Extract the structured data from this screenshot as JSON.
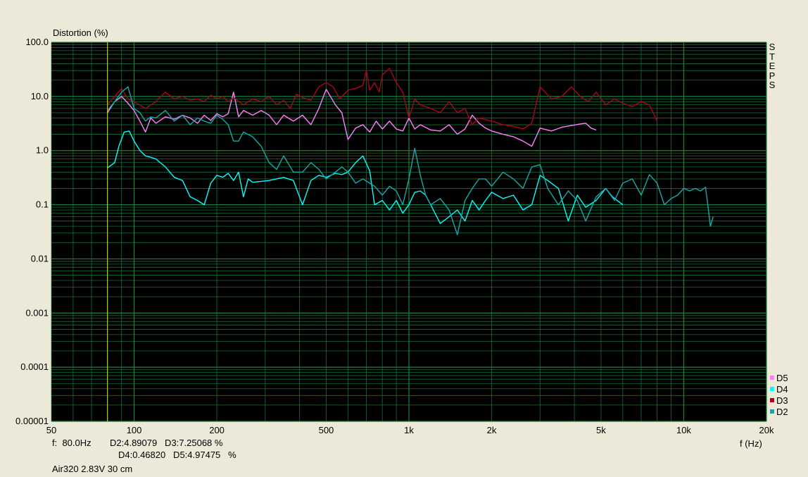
{
  "chart_data": {
    "type": "line",
    "title": "",
    "ylabel": "Distortion (%)",
    "xlabel": "f (Hz)",
    "xscale": "log",
    "yscale": "log",
    "xlim": [
      50,
      20000
    ],
    "ylim": [
      1e-05,
      100
    ],
    "grid": true,
    "background": "#000000",
    "grid_color": "#1f7f3c",
    "x_ticks": [
      "50",
      "100",
      "200",
      "500",
      "1k",
      "2k",
      "5k",
      "10k",
      "20k"
    ],
    "x_tick_values": [
      50,
      100,
      200,
      500,
      1000,
      2000,
      5000,
      10000,
      20000
    ],
    "y_ticks": [
      "100.0",
      "10.0",
      "1.0",
      "0.1",
      "0.01",
      "0.001",
      "0.0001",
      "0.00001"
    ],
    "y_tick_values": [
      100,
      10,
      1,
      0.1,
      0.01,
      0.001,
      0.0001,
      1e-05
    ],
    "cursor_hz": 80,
    "cursor_color": "#e6e600",
    "side_label": "STEPS",
    "legend_position": "bottom-right",
    "series": [
      {
        "name": "D5",
        "color": "#ff80ff",
        "points": [
          [
            80,
            5
          ],
          [
            85,
            8
          ],
          [
            90,
            10
          ],
          [
            95,
            7.5
          ],
          [
            100,
            5.5
          ],
          [
            105,
            3.5
          ],
          [
            110,
            2.2
          ],
          [
            115,
            4
          ],
          [
            120,
            3.2
          ],
          [
            130,
            4.2
          ],
          [
            140,
            3.8
          ],
          [
            150,
            4.5
          ],
          [
            160,
            4
          ],
          [
            170,
            3.2
          ],
          [
            180,
            4.5
          ],
          [
            190,
            3.6
          ],
          [
            200,
            4.8
          ],
          [
            210,
            4.2
          ],
          [
            220,
            4.8
          ],
          [
            230,
            12
          ],
          [
            240,
            4.2
          ],
          [
            250,
            5.5
          ],
          [
            270,
            4.5
          ],
          [
            290,
            5.5
          ],
          [
            310,
            4.5
          ],
          [
            330,
            3
          ],
          [
            350,
            4.5
          ],
          [
            380,
            3.5
          ],
          [
            410,
            4.5
          ],
          [
            440,
            3
          ],
          [
            470,
            6
          ],
          [
            500,
            13.5
          ],
          [
            540,
            7
          ],
          [
            570,
            5
          ],
          [
            600,
            1.6
          ],
          [
            640,
            2.6
          ],
          [
            680,
            3
          ],
          [
            720,
            2.2
          ],
          [
            760,
            3.5
          ],
          [
            800,
            2.5
          ],
          [
            850,
            3.5
          ],
          [
            900,
            2.5
          ],
          [
            950,
            2.3
          ],
          [
            1000,
            4
          ],
          [
            1050,
            2.5
          ],
          [
            1100,
            3
          ],
          [
            1200,
            2.4
          ],
          [
            1300,
            2.3
          ],
          [
            1400,
            3
          ],
          [
            1500,
            2
          ],
          [
            1600,
            2.5
          ],
          [
            1700,
            4.5
          ],
          [
            1800,
            3.2
          ],
          [
            1900,
            2.6
          ],
          [
            2000,
            2.3
          ],
          [
            2200,
            2
          ],
          [
            2400,
            1.8
          ],
          [
            2600,
            1.5
          ],
          [
            2800,
            1.2
          ],
          [
            3000,
            2.6
          ],
          [
            3300,
            2.3
          ],
          [
            3600,
            2.7
          ],
          [
            3900,
            2.9
          ],
          [
            4200,
            3.1
          ],
          [
            4400,
            3.2
          ],
          [
            4600,
            2.6
          ],
          [
            4800,
            2.4
          ]
        ]
      },
      {
        "name": "D4",
        "color": "#00ffff",
        "points": [
          [
            80,
            0.48
          ],
          [
            85,
            0.6
          ],
          [
            88,
            1.2
          ],
          [
            92,
            2.2
          ],
          [
            96,
            2.3
          ],
          [
            100,
            1.5
          ],
          [
            105,
            1
          ],
          [
            110,
            0.8
          ],
          [
            115,
            0.75
          ],
          [
            120,
            0.7
          ],
          [
            130,
            0.5
          ],
          [
            140,
            0.32
          ],
          [
            150,
            0.28
          ],
          [
            160,
            0.14
          ],
          [
            170,
            0.12
          ],
          [
            180,
            0.1
          ],
          [
            190,
            0.25
          ],
          [
            200,
            0.35
          ],
          [
            210,
            0.32
          ],
          [
            220,
            0.38
          ],
          [
            230,
            0.28
          ],
          [
            240,
            0.4
          ],
          [
            250,
            0.14
          ],
          [
            260,
            0.3
          ],
          [
            270,
            0.26
          ],
          [
            290,
            0.27
          ],
          [
            310,
            0.28
          ],
          [
            330,
            0.3
          ],
          [
            350,
            0.32
          ],
          [
            380,
            0.28
          ],
          [
            410,
            0.1
          ],
          [
            440,
            0.28
          ],
          [
            470,
            0.35
          ],
          [
            500,
            0.32
          ],
          [
            540,
            0.38
          ],
          [
            570,
            0.36
          ],
          [
            600,
            0.4
          ],
          [
            640,
            0.6
          ],
          [
            680,
            0.8
          ],
          [
            720,
            0.42
          ],
          [
            750,
            0.1
          ],
          [
            800,
            0.12
          ],
          [
            850,
            0.08
          ],
          [
            900,
            0.12
          ],
          [
            950,
            0.07
          ],
          [
            1000,
            0.1
          ],
          [
            1050,
            0.17
          ],
          [
            1100,
            0.18
          ],
          [
            1150,
            0.15
          ],
          [
            1200,
            0.1
          ],
          [
            1300,
            0.045
          ],
          [
            1400,
            0.06
          ],
          [
            1500,
            0.08
          ],
          [
            1600,
            0.05
          ],
          [
            1700,
            0.12
          ],
          [
            1800,
            0.08
          ],
          [
            1900,
            0.12
          ],
          [
            2000,
            0.17
          ],
          [
            2200,
            0.13
          ],
          [
            2400,
            0.15
          ],
          [
            2600,
            0.08
          ],
          [
            2800,
            0.1
          ],
          [
            3000,
            0.35
          ],
          [
            3200,
            0.28
          ],
          [
            3500,
            0.2
          ],
          [
            3800,
            0.05
          ],
          [
            4100,
            0.15
          ],
          [
            4400,
            0.09
          ],
          [
            4800,
            0.12
          ],
          [
            5200,
            0.2
          ],
          [
            5500,
            0.14
          ],
          [
            6000,
            0.1
          ]
        ]
      },
      {
        "name": "D3",
        "color": "#b0001c",
        "points": [
          [
            80,
            7
          ],
          [
            85,
            10
          ],
          [
            90,
            14
          ],
          [
            95,
            9
          ],
          [
            100,
            8
          ],
          [
            110,
            6
          ],
          [
            120,
            8
          ],
          [
            130,
            12
          ],
          [
            140,
            9
          ],
          [
            150,
            10
          ],
          [
            160,
            8.5
          ],
          [
            170,
            9
          ],
          [
            180,
            8
          ],
          [
            190,
            10.5
          ],
          [
            200,
            9
          ],
          [
            210,
            10
          ],
          [
            220,
            8
          ],
          [
            230,
            9.5
          ],
          [
            250,
            7
          ],
          [
            270,
            9
          ],
          [
            290,
            8
          ],
          [
            310,
            10
          ],
          [
            330,
            7
          ],
          [
            350,
            8.5
          ],
          [
            370,
            6
          ],
          [
            390,
            11
          ],
          [
            410,
            9.5
          ],
          [
            440,
            8.5
          ],
          [
            470,
            15
          ],
          [
            500,
            18
          ],
          [
            530,
            15
          ],
          [
            560,
            9
          ],
          [
            600,
            13
          ],
          [
            640,
            14
          ],
          [
            680,
            16
          ],
          [
            700,
            30
          ],
          [
            720,
            13
          ],
          [
            750,
            18
          ],
          [
            780,
            12
          ],
          [
            800,
            25
          ],
          [
            850,
            33
          ],
          [
            900,
            18
          ],
          [
            950,
            12
          ],
          [
            1000,
            4
          ],
          [
            1050,
            9
          ],
          [
            1100,
            7
          ],
          [
            1200,
            6
          ],
          [
            1300,
            5
          ],
          [
            1400,
            8
          ],
          [
            1500,
            5
          ],
          [
            1600,
            6
          ],
          [
            1700,
            3
          ],
          [
            1800,
            4
          ],
          [
            2000,
            3.5
          ],
          [
            2200,
            3
          ],
          [
            2400,
            2.8
          ],
          [
            2600,
            2.5
          ],
          [
            2800,
            3.2
          ],
          [
            3000,
            15
          ],
          [
            3300,
            9
          ],
          [
            3600,
            10
          ],
          [
            3900,
            15
          ],
          [
            4200,
            10
          ],
          [
            4500,
            8
          ],
          [
            4800,
            12
          ],
          [
            5200,
            7
          ],
          [
            5600,
            9
          ],
          [
            6000,
            7.5
          ],
          [
            6500,
            6.5
          ],
          [
            7000,
            8
          ],
          [
            7500,
            7
          ],
          [
            8000,
            3.5
          ]
        ]
      },
      {
        "name": "D2",
        "color": "#1aa6a6",
        "points": [
          [
            80,
            5.5
          ],
          [
            85,
            8
          ],
          [
            90,
            12
          ],
          [
            95,
            15
          ],
          [
            100,
            6
          ],
          [
            105,
            5
          ],
          [
            110,
            3.5
          ],
          [
            115,
            4.2
          ],
          [
            120,
            4
          ],
          [
            130,
            5.5
          ],
          [
            140,
            3.5
          ],
          [
            150,
            4.5
          ],
          [
            160,
            3
          ],
          [
            170,
            4
          ],
          [
            180,
            3.5
          ],
          [
            190,
            3.2
          ],
          [
            200,
            4.5
          ],
          [
            210,
            3.8
          ],
          [
            220,
            3
          ],
          [
            230,
            1.5
          ],
          [
            240,
            1.5
          ],
          [
            250,
            2.2
          ],
          [
            270,
            1.8
          ],
          [
            290,
            1.2
          ],
          [
            310,
            0.6
          ],
          [
            330,
            0.45
          ],
          [
            350,
            0.8
          ],
          [
            380,
            0.4
          ],
          [
            410,
            0.4
          ],
          [
            440,
            0.6
          ],
          [
            470,
            0.45
          ],
          [
            500,
            0.3
          ],
          [
            540,
            0.4
          ],
          [
            570,
            0.5
          ],
          [
            600,
            0.4
          ],
          [
            640,
            0.25
          ],
          [
            680,
            0.3
          ],
          [
            720,
            0.25
          ],
          [
            750,
            0.22
          ],
          [
            800,
            0.15
          ],
          [
            850,
            0.22
          ],
          [
            900,
            0.18
          ],
          [
            950,
            0.1
          ],
          [
            1000,
            0.3
          ],
          [
            1050,
            1.1
          ],
          [
            1100,
            0.35
          ],
          [
            1150,
            0.15
          ],
          [
            1200,
            0.1
          ],
          [
            1300,
            0.13
          ],
          [
            1400,
            0.08
          ],
          [
            1500,
            0.028
          ],
          [
            1600,
            0.12
          ],
          [
            1700,
            0.2
          ],
          [
            1800,
            0.3
          ],
          [
            1900,
            0.3
          ],
          [
            2000,
            0.22
          ],
          [
            2200,
            0.4
          ],
          [
            2400,
            0.3
          ],
          [
            2600,
            0.2
          ],
          [
            2800,
            0.5
          ],
          [
            3000,
            0.55
          ],
          [
            3200,
            0.2
          ],
          [
            3500,
            0.1
          ],
          [
            3800,
            0.18
          ],
          [
            4100,
            0.12
          ],
          [
            4400,
            0.05
          ],
          [
            4800,
            0.14
          ],
          [
            5200,
            0.2
          ],
          [
            5600,
            0.12
          ],
          [
            6000,
            0.25
          ],
          [
            6500,
            0.3
          ],
          [
            7000,
            0.15
          ],
          [
            7500,
            0.36
          ],
          [
            8000,
            0.25
          ],
          [
            8500,
            0.1
          ],
          [
            9000,
            0.13
          ],
          [
            9500,
            0.15
          ],
          [
            10000,
            0.2
          ],
          [
            10500,
            0.18
          ],
          [
            11000,
            0.2
          ],
          [
            11500,
            0.18
          ],
          [
            12000,
            0.21
          ],
          [
            12300,
            0.08
          ],
          [
            12500,
            0.04
          ],
          [
            12800,
            0.06
          ]
        ]
      }
    ]
  },
  "footer": {
    "freq": "f:  80.0Hz",
    "line1": "D2:4.89079   D3:7.25068 %",
    "line2": "D4:0.46820   D5:4.97475   %",
    "device": "Air320 2.83V 30 cm"
  }
}
